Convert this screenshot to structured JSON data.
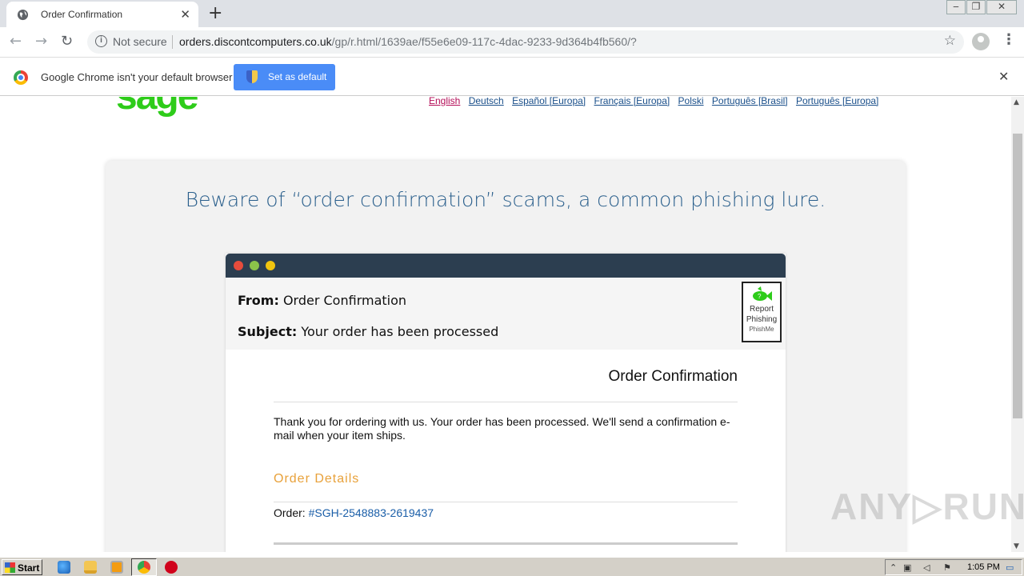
{
  "browser": {
    "tab_title": "Order Confirmation",
    "tab_close": "✕",
    "new_tab": "+",
    "window_controls": [
      "‒",
      "❐",
      "✕"
    ],
    "nav": {
      "back": "←",
      "forward": "→",
      "reload": "↻"
    },
    "security_label": "Not secure",
    "url_host": "orders.discontcomputers.co.uk",
    "url_path": "/gp/r.html/1639ae/f55e6e09-117c-4dac-9233-9d364b4fb560/?",
    "star": "☆",
    "menu": "⋮"
  },
  "infobar": {
    "message": "Google Chrome isn't your default browser",
    "button": "Set as default",
    "close": "✕"
  },
  "page": {
    "logo_text": "sage",
    "languages": [
      {
        "label": "English",
        "active": true
      },
      {
        "label": "Deutsch"
      },
      {
        "label": "Español [Europa]"
      },
      {
        "label": "Français [Europa]"
      },
      {
        "label": "Polski"
      },
      {
        "label": "Português [Brasil]"
      },
      {
        "label": "Português [Europa]"
      }
    ],
    "headline": "Beware of “order confirmation” scams, a common phishing lure.",
    "email": {
      "from_label": "From:",
      "from_value": "Order Confirmation",
      "subject_label": "Subject:",
      "subject_value": "Your order has been processed",
      "report_line1": "Report",
      "report_line2": "Phishing",
      "report_brand": "PhishMe",
      "heading": "Order Confirmation",
      "body": "Thank you for ordering with us. Your order has been processed. We'll send a confirmation e-mail when your item ships.",
      "details_heading": "Order Details",
      "order_label": "Order:",
      "order_number": "#SGH-2548883-2619437"
    },
    "colors": {
      "logo": "#2ecc1a",
      "headline": "#2a5f8c",
      "details": "#e8a13a",
      "link": "#1a5ea8"
    }
  },
  "watermark": "ANY▷RUN",
  "taskbar": {
    "start": "Start",
    "clock": "1:05 PM"
  }
}
